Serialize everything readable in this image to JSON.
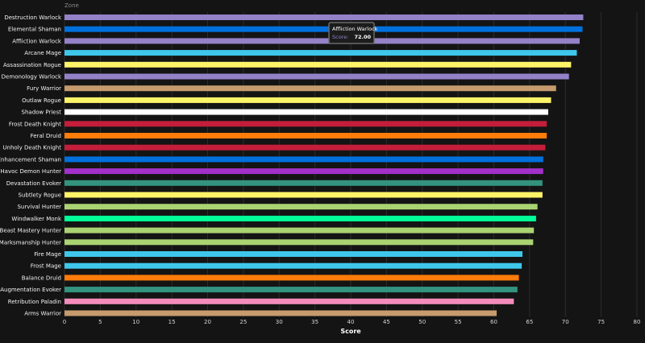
{
  "chart_data": {
    "type": "bar",
    "orientation": "horizontal",
    "top_label": "Zone",
    "xlabel": "Score",
    "ylabel": "",
    "xlim": [
      0,
      80
    ],
    "xticks": [
      0,
      5,
      10,
      15,
      20,
      25,
      30,
      35,
      40,
      45,
      50,
      55,
      60,
      65,
      70,
      75,
      80
    ],
    "grid": true,
    "categories": [
      "Destruction Warlock",
      "Elemental Shaman",
      "Affliction Warlock",
      "Arcane Mage",
      "Assassination Rogue",
      "Demonology Warlock",
      "Fury Warrior",
      "Outlaw Rogue",
      "Shadow Priest",
      "Frost Death Knight",
      "Feral Druid",
      "Unholy Death Knight",
      "Enhancement Shaman",
      "Havoc Demon Hunter",
      "Devastation Evoker",
      "Subtlety Rogue",
      "Survival Hunter",
      "Windwalker Monk",
      "Beast Mastery Hunter",
      "Marksmanship Hunter",
      "Fire Mage",
      "Frost Mage",
      "Balance Druid",
      "Augmentation Evoker",
      "Retribution Paladin",
      "Arms Warrior"
    ],
    "values": [
      72.5,
      72.4,
      72.0,
      71.6,
      70.8,
      70.5,
      68.7,
      68.0,
      67.6,
      67.4,
      67.4,
      67.2,
      66.9,
      66.9,
      66.8,
      66.8,
      66.1,
      65.9,
      65.6,
      65.5,
      64.0,
      63.9,
      63.5,
      63.3,
      62.8,
      60.4
    ],
    "colors": [
      "#9482c9",
      "#0070dd",
      "#9482c9",
      "#3fc7eb",
      "#fff468",
      "#9482c9",
      "#c69b6d",
      "#fff468",
      "#ffffff",
      "#c41e3a",
      "#ff7c0a",
      "#c41e3a",
      "#0070dd",
      "#a330c9",
      "#33937f",
      "#fff468",
      "#aad372",
      "#00ff98",
      "#aad372",
      "#aad372",
      "#3fc7eb",
      "#3fc7eb",
      "#ff7c0a",
      "#33937f",
      "#f48cba",
      "#c69b6d"
    ],
    "tooltip": {
      "title": "Affliction Warlock",
      "label": "Score:",
      "value": "72.00",
      "color": "#9482c9"
    }
  }
}
